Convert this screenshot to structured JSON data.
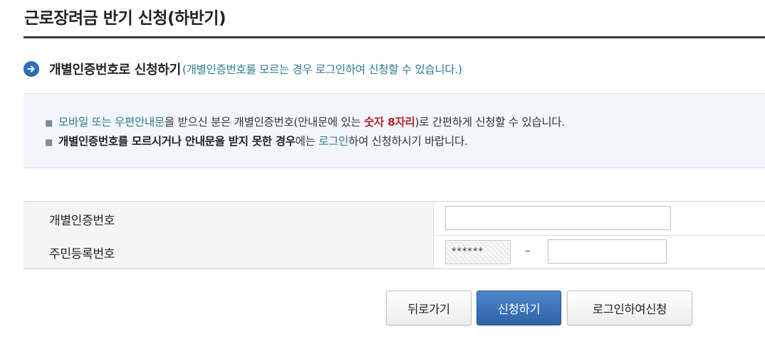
{
  "page": {
    "title": "근로장려금 반기 신청(하반기)"
  },
  "section": {
    "title": "개별인증번호로 신청하기",
    "subtitle": "(개별인증번호를 모르는 경우 로그인하여 신청할 수 있습니다.)",
    "icon": "arrow-right-icon"
  },
  "info": {
    "line1": {
      "part1": "모바일 또는 우편안내문",
      "part2": "을 받으신 분은 개별인증번호(안내문에 있는 ",
      "part3": "숫자 8자리",
      "part4": ")로 간편하게 신청할 수 있습니다."
    },
    "line2": {
      "part1": "개별인증번호를 모르시거나 안내문을 받지 못한 경우",
      "part2": "에는 ",
      "part3": "로그인",
      "part4": "하여 신청하시기 바랍니다."
    }
  },
  "form": {
    "auth_label": "개별인증번호",
    "auth_value": "",
    "rrn_label": "주민등록번호",
    "rrn_front_masked": "******",
    "rrn_separator": "–",
    "rrn_back_value": ""
  },
  "buttons": {
    "back": "뒤로가기",
    "apply": "신청하기",
    "login_apply": "로그인하여신청"
  },
  "colors": {
    "accent_blue": "#2a6fbf",
    "link_teal": "#2a7a8c",
    "highlight_red": "#b0262d"
  }
}
